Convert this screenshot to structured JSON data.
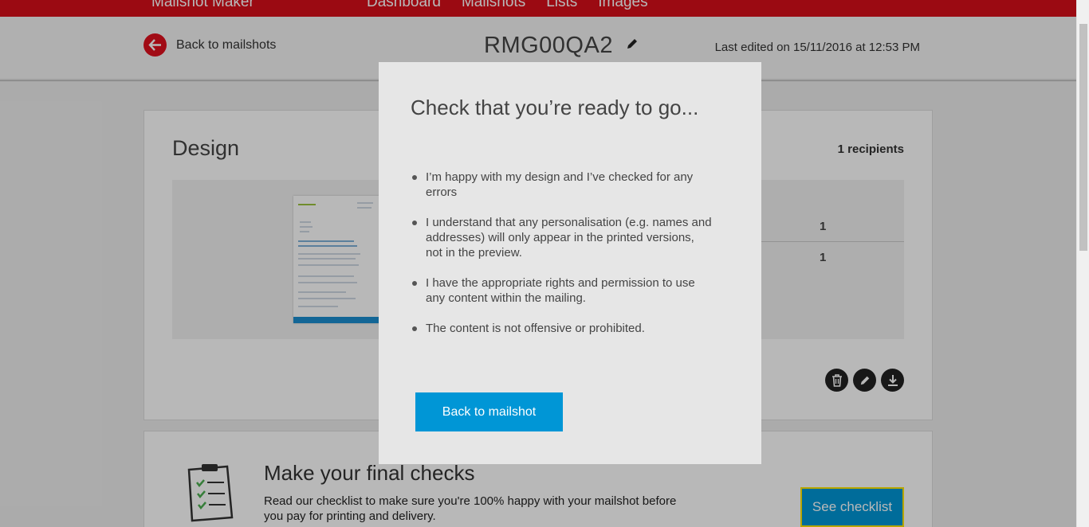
{
  "nav": {
    "brand": "Mailshot Maker",
    "items": [
      "Dashboard",
      "Mailshots",
      "Lists",
      "Images"
    ]
  },
  "header": {
    "back_label": "Back to mailshots",
    "title": "RMG00QA2",
    "last_edited": "Last edited on 15/11/2016 at 12:53 PM"
  },
  "design": {
    "title": "Design",
    "recipients": "1 recipients",
    "stats": [
      "1",
      "1"
    ]
  },
  "checks": {
    "title": "Make your final checks",
    "description": "Read our checklist to make sure you're 100% happy with your mailshot before you pay for printing and delivery.",
    "button": "See checklist"
  },
  "modal": {
    "title": "Check that you’re ready to go...",
    "items": [
      "I’m happy with my design and I’ve checked for any errors",
      "I understand that any personalisation (e.g. names and addresses) will only appear in the printed versions, not in the preview.",
      "I have the appropriate rights and permission to use any content within the mailing.",
      "The content is not offensive or prohibited."
    ],
    "button": "Back to mailshot"
  },
  "colors": {
    "brand_red": "#d70f1a",
    "accent_blue": "#0096d6",
    "highlight_yellow": "#ffe600"
  }
}
